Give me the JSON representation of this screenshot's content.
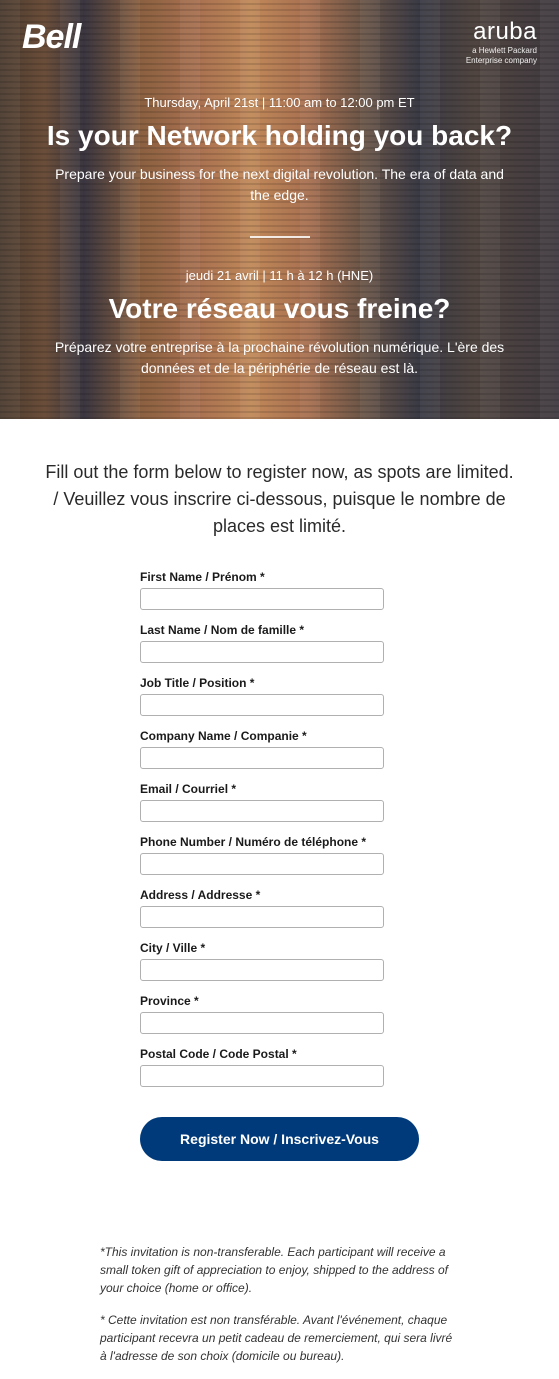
{
  "logos": {
    "bell": "Bell",
    "aruba": "aruba",
    "aruba_sub1": "a Hewlett Packard",
    "aruba_sub2": "Enterprise company"
  },
  "hero_en": {
    "datetime": "Thursday, April 21st | 11:00 am to 12:00 pm ET",
    "title": "Is your Network holding you back?",
    "subtitle": "Prepare your business for the next digital revolution. The era of data and the edge."
  },
  "hero_fr": {
    "datetime": "jeudi 21 avril | 11 h à 12 h (HNE)",
    "title": "Votre réseau vous freine?",
    "subtitle": "Préparez votre entreprise à la prochaine révolution numérique. L'ère des données et de la périphérie de réseau est là."
  },
  "form_intro": "Fill out the form below to register now, as spots are limited. / Veuillez vous inscrire ci-dessous, puisque le nombre de places est limité.",
  "fields": {
    "first_name": "First Name / Prénom *",
    "last_name": "Last Name / Nom de famille *",
    "job_title": "Job Title / Position *",
    "company": "Company Name / Companie *",
    "email": "Email / Courriel *",
    "phone": "Phone Number / Numéro de téléphone *",
    "address": "Address / Addresse *",
    "city": "City / Ville *",
    "province": "Province *",
    "postal": "Postal Code / Code Postal *"
  },
  "submit_label": "Register Now / Inscrivez-Vous",
  "disclaimer_en": "*This invitation is non-transferable. Each participant will receive a small token gift of appreciation to enjoy, shipped to the address of your choice (home or office).",
  "disclaimer_fr": "* Cette invitation est non transférable. Avant l'événement, chaque participant recevra un petit cadeau de remerciement, qui sera livré à l'adresse de son choix (domicile ou bureau)."
}
